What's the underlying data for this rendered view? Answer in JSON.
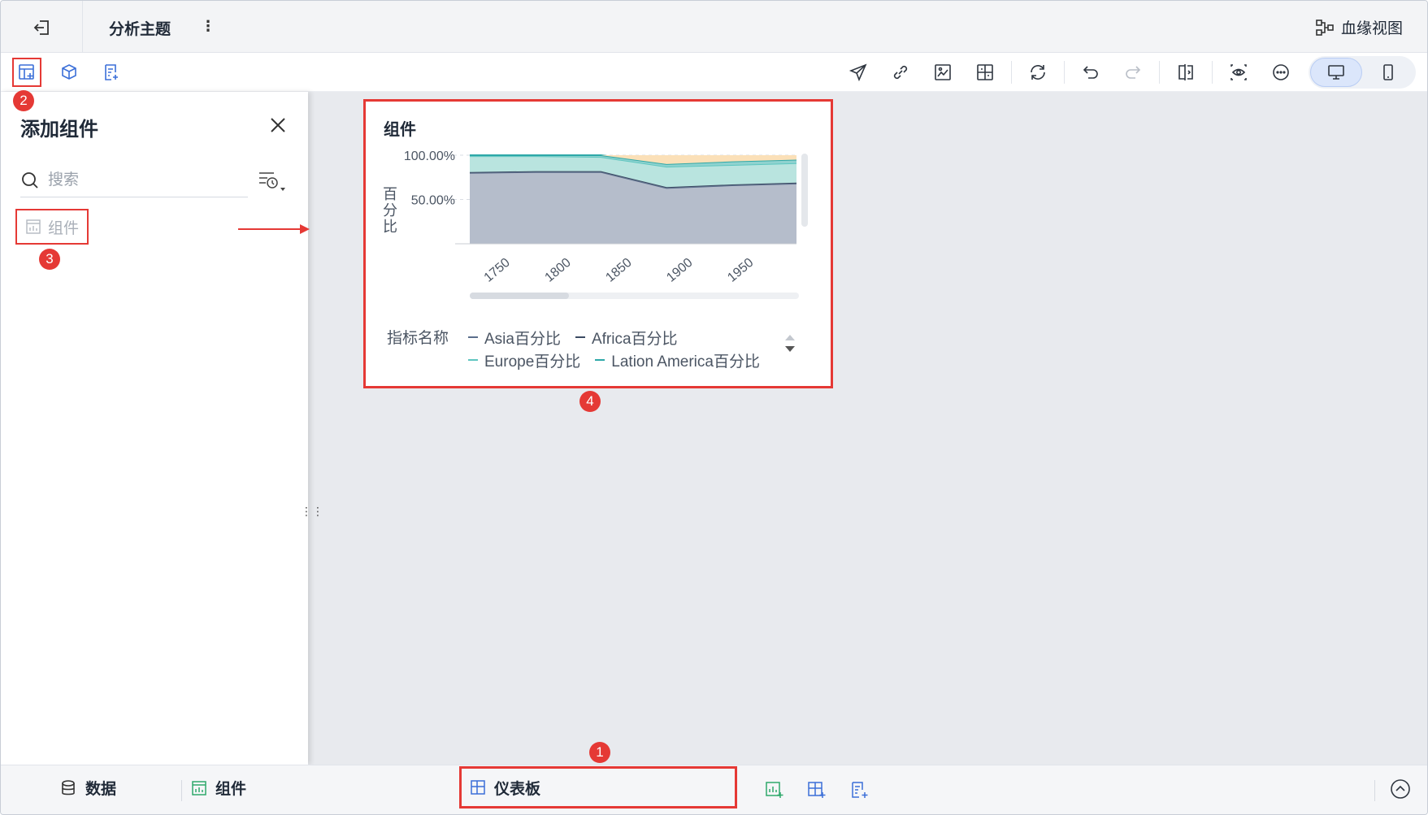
{
  "topbar": {
    "title": "分析主题",
    "lineage_label": "血缘视图"
  },
  "panel": {
    "title": "添加组件",
    "search_placeholder": "搜索",
    "item_label": "组件"
  },
  "card": {
    "title": "组件",
    "legend_title": "指标名称"
  },
  "chart_data": {
    "type": "area",
    "stacked": true,
    "percent": true,
    "title": "组件",
    "ylabel": "百分比",
    "y_ticks": [
      "100.00%",
      "50.00%"
    ],
    "x_ticks": [
      "1750",
      "1800",
      "1850",
      "1900",
      "1950"
    ],
    "x": [
      1750,
      1800,
      1850,
      1900,
      1950,
      1999
    ],
    "series": [
      {
        "name": "Asia百分比",
        "values": [
          80,
          81,
          81,
          63,
          66,
          68
        ],
        "color": "#5b6e8c"
      },
      {
        "name": "Africa百分比",
        "values": [
          1,
          1,
          1,
          1,
          1,
          1
        ],
        "color": "#3b4a63"
      },
      {
        "name": "Europe百分比",
        "values": [
          18,
          17,
          16,
          23,
          22,
          22
        ],
        "color": "#5fc6c0"
      },
      {
        "name": "Lation America百分比",
        "values": [
          1,
          1,
          2,
          3,
          4,
          4
        ],
        "color": "#2ea8a8"
      }
    ],
    "ylim": [
      0,
      100
    ],
    "grid": true,
    "legend_position": "bottom"
  },
  "bottombar": {
    "tab_data": "数据",
    "tab_component": "组件",
    "tab_dashboard": "仪表板"
  },
  "badges": [
    "1",
    "2",
    "3",
    "4"
  ],
  "colors": {
    "accent": "#3b6fd8",
    "highlight": "#e53935"
  }
}
